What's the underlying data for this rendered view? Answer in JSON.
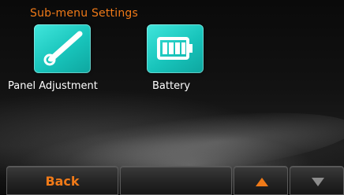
{
  "header": {
    "title": "Sub-menu Settings"
  },
  "menu": {
    "items": [
      {
        "label": "Panel Adjustment",
        "icon": "panel-adjustment-icon"
      },
      {
        "label": "Battery",
        "icon": "battery-icon"
      }
    ]
  },
  "toolbar": {
    "back_label": "Back",
    "up_icon": "arrow-up-icon",
    "down_icon": "arrow-down-icon"
  },
  "colors": {
    "accent": "#f07a18",
    "icon_teal": "#1fcfc4",
    "background": "#000000",
    "disabled_arrow": "#8c8c8c"
  }
}
